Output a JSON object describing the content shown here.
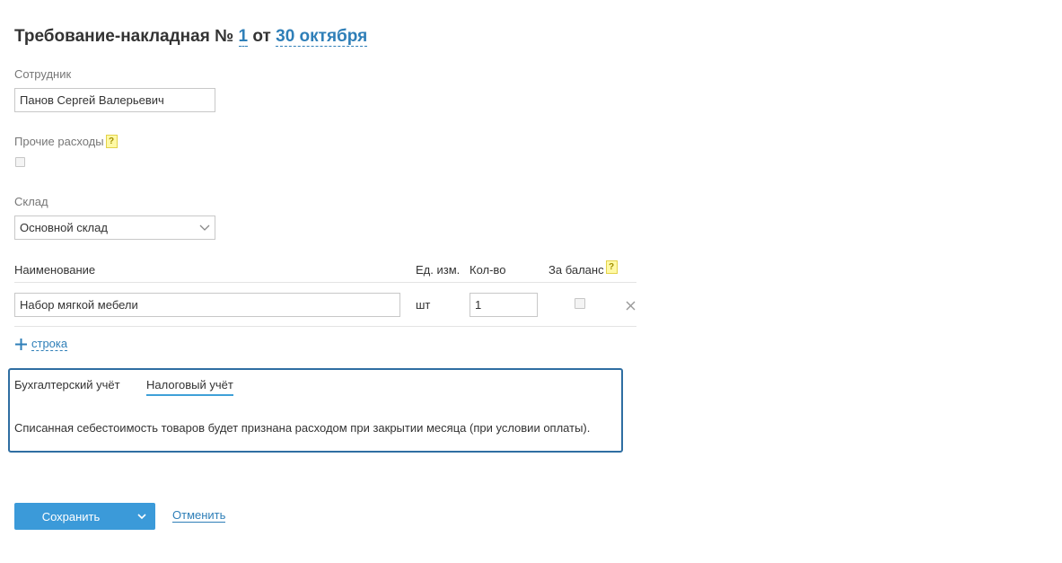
{
  "header": {
    "prefix": "Требование-накладная №",
    "number": "1",
    "from": "от",
    "date": "30 октября"
  },
  "employee": {
    "label": "Сотрудник",
    "value": "Панов Сергей Валерьевич"
  },
  "other_expenses": {
    "label": "Прочие расходы",
    "help": "?",
    "checked": false
  },
  "warehouse": {
    "label": "Склад",
    "selected": "Основной склад"
  },
  "table": {
    "headers": {
      "name": "Наименование",
      "unit": "Ед. изм.",
      "qty": "Кол-во",
      "off_balance": "За баланс",
      "help": "?"
    },
    "rows": [
      {
        "name": "Набор мягкой мебели",
        "unit": "шт",
        "qty": "1",
        "off_balance": false
      }
    ],
    "add_row": "строка"
  },
  "accounting": {
    "tabs": [
      "Бухгалтерский учёт",
      "Налоговый учёт"
    ],
    "active_tab": 1,
    "message": "Списанная себестоимость товаров будет признана расходом при закрытии месяца (при условии оплаты)."
  },
  "actions": {
    "save": "Сохранить",
    "cancel": "Отменить"
  },
  "colors": {
    "accent": "#2f7fb8",
    "button": "#3b9ad9",
    "panel_border": "#2f6ea2"
  }
}
